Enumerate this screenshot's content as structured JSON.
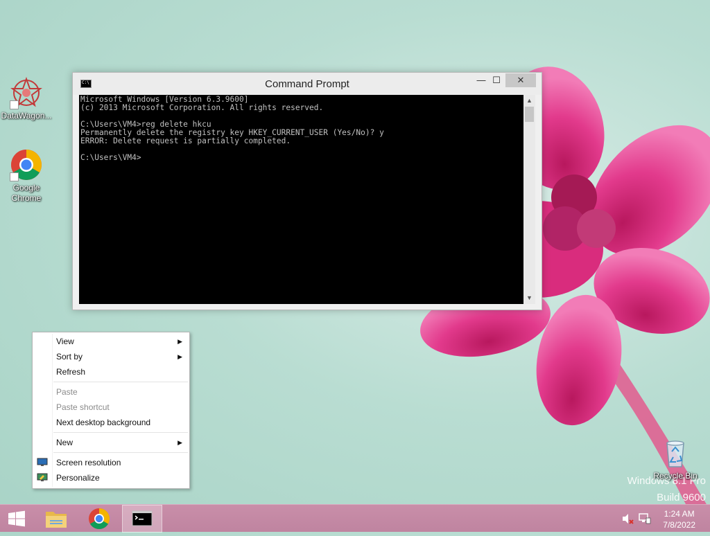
{
  "desktop": {
    "icons": [
      {
        "label": "DataWagon...",
        "icon": "datawagon-icon"
      },
      {
        "label": "Google Chrome",
        "icon": "chrome-icon"
      },
      {
        "label": "Recycle Bin",
        "icon": "recycle-bin-icon"
      }
    ],
    "watermark": {
      "line1": "Windows 8.1 Pro",
      "line2": "Build 9600"
    }
  },
  "cmd_window": {
    "title": "Command Prompt",
    "minimize": "—",
    "maximize": "☐",
    "close": "✕",
    "console_lines": [
      "Microsoft Windows [Version 6.3.9600]",
      "(c) 2013 Microsoft Corporation. All rights reserved.",
      "",
      "C:\\Users\\VM4>reg delete hkcu",
      "Permanently delete the registry key HKEY_CURRENT_USER (Yes/No)? y",
      "ERROR: Delete request is partially completed.",
      "",
      "C:\\Users\\VM4>"
    ]
  },
  "context_menu": {
    "items": [
      {
        "label": "View",
        "submenu": true,
        "enabled": true
      },
      {
        "label": "Sort by",
        "submenu": true,
        "enabled": true
      },
      {
        "label": "Refresh",
        "submenu": false,
        "enabled": true
      },
      {
        "label": "Paste",
        "submenu": false,
        "enabled": false
      },
      {
        "label": "Paste shortcut",
        "submenu": false,
        "enabled": false
      },
      {
        "label": "Next desktop background",
        "submenu": false,
        "enabled": true
      },
      {
        "label": "New",
        "submenu": true,
        "enabled": true
      },
      {
        "label": "Screen resolution",
        "submenu": false,
        "enabled": true,
        "icon": "monitor-icon"
      },
      {
        "label": "Personalize",
        "submenu": false,
        "enabled": true,
        "icon": "personalize-icon"
      }
    ]
  },
  "taskbar": {
    "buttons": [
      {
        "name": "start",
        "icon": "windows-logo-icon"
      },
      {
        "name": "file-explorer",
        "icon": "folder-icon"
      },
      {
        "name": "chrome",
        "icon": "chrome-icon"
      },
      {
        "name": "command-prompt",
        "icon": "cmd-icon",
        "active": true
      }
    ],
    "clock": {
      "time": "1:24 AM",
      "date": "7/8/2022"
    }
  },
  "colors": {
    "taskbar": "#c48aa5",
    "console_bg": "#000000",
    "console_fg": "#c0c0c0",
    "flower": "#e8338a"
  }
}
